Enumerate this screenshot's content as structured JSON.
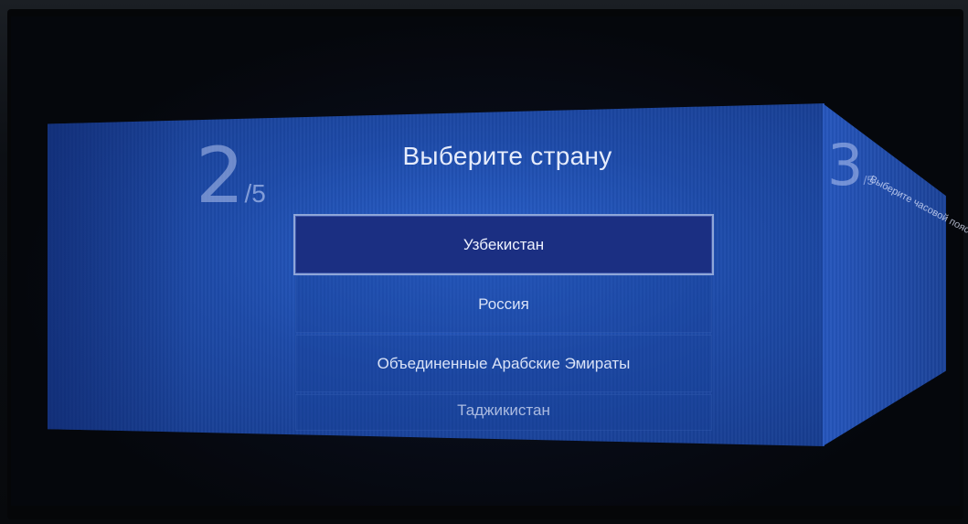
{
  "wizard": {
    "current_step": "2",
    "total_label": "/5",
    "title": "Выберите страну",
    "countries": [
      {
        "label": "Узбекистан",
        "selected": true
      },
      {
        "label": "Россия",
        "selected": false
      },
      {
        "label": "Объединенные Арабские Эмираты",
        "selected": false
      },
      {
        "label": "Таджикистан",
        "selected": false
      }
    ]
  },
  "next_panel": {
    "step": "3",
    "total_label": "/5",
    "title": "Выберите часовой пояс"
  },
  "colors": {
    "panel_blue": "#2a62cf",
    "selected_item": "#1b2f82",
    "selected_border": "#8fa6d8"
  }
}
